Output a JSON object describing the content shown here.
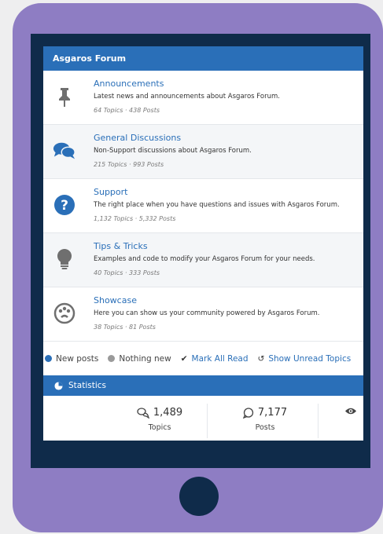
{
  "forum": {
    "header": "Asgaros Forum",
    "categories": [
      {
        "title": "Announcements",
        "description": "Latest news and announcements about Asgaros Forum.",
        "meta": "64 Topics · 438 Posts",
        "icon": "pin-icon"
      },
      {
        "title": "General Discussions",
        "description": "Non-Support discussions about Asgaros Forum.",
        "meta": "215 Topics · 993 Posts",
        "icon": "chat-bubbles-icon"
      },
      {
        "title": "Support",
        "description": "The right place when you have questions and issues with Asgaros Forum.",
        "meta": "1,132 Topics · 5,332 Posts",
        "icon": "question-circle-icon"
      },
      {
        "title": "Tips & Tricks",
        "description": "Examples and code to modify your Asgaros Forum for your needs.",
        "meta": "40 Topics · 333 Posts",
        "icon": "lightbulb-icon"
      },
      {
        "title": "Showcase",
        "description": "Here you can show us your community powered by Asgaros Forum.",
        "meta": "38 Topics · 81 Posts",
        "icon": "palette-icon"
      }
    ]
  },
  "legend": {
    "new_posts": "New posts",
    "nothing_new": "Nothing new",
    "mark_all_read": "Mark All Read",
    "show_unread": "Show Unread Topics"
  },
  "statistics": {
    "header": "Statistics",
    "topics_value": "1,489",
    "topics_label": "Topics",
    "posts_value": "7,177",
    "posts_label": "Posts"
  },
  "colors": {
    "accent": "#2a6fb8",
    "device": "#8e7dc3",
    "bezel": "#0f2b4a",
    "icon_gray": "#6f6f6f"
  }
}
